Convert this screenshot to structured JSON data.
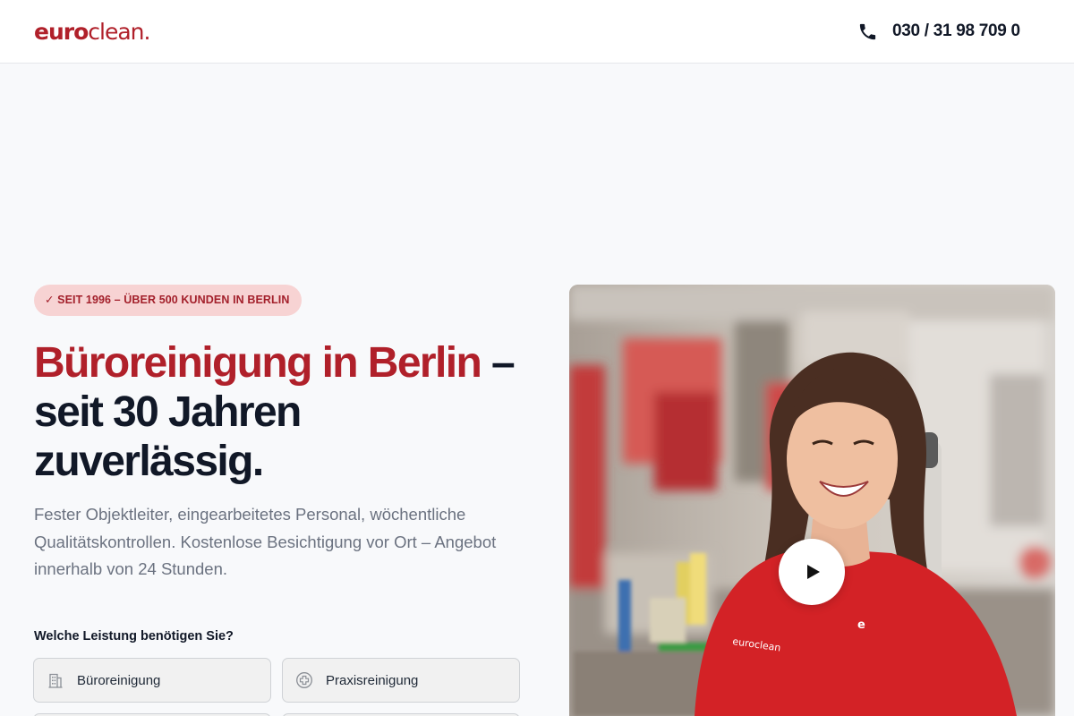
{
  "header": {
    "logo": {
      "bold": "euro",
      "light": "clean."
    },
    "phone": "030 / 31 98 709 0"
  },
  "hero": {
    "badge": "✓ SEIT 1996 – ÜBER 500 KUNDEN IN BERLIN",
    "headline_accent": "Büroreinigung in Berlin",
    "headline_rest": " – seit 30 Jahren zuverlässig.",
    "lead": "Fester Objektleiter, eingearbeitetes Personal, wöchentliche Qualitätskontrollen. Kostenlose Besichtigung vor Ort – Angebot innerhalb von 24 Stunden.",
    "service_question": "Welche Leistung benötigen Sie?",
    "services": [
      {
        "label": "Büroreinigung",
        "icon": "building-icon"
      },
      {
        "label": "Praxisreinigung",
        "icon": "medical-cross-icon"
      }
    ]
  },
  "video": {
    "shirt_logo": "euroclean",
    "play_icon": "play-icon"
  },
  "colors": {
    "brand_red": "#b0202a",
    "badge_bg": "#f7d3d3",
    "text_dark": "#111827",
    "text_muted": "#6b7280"
  }
}
